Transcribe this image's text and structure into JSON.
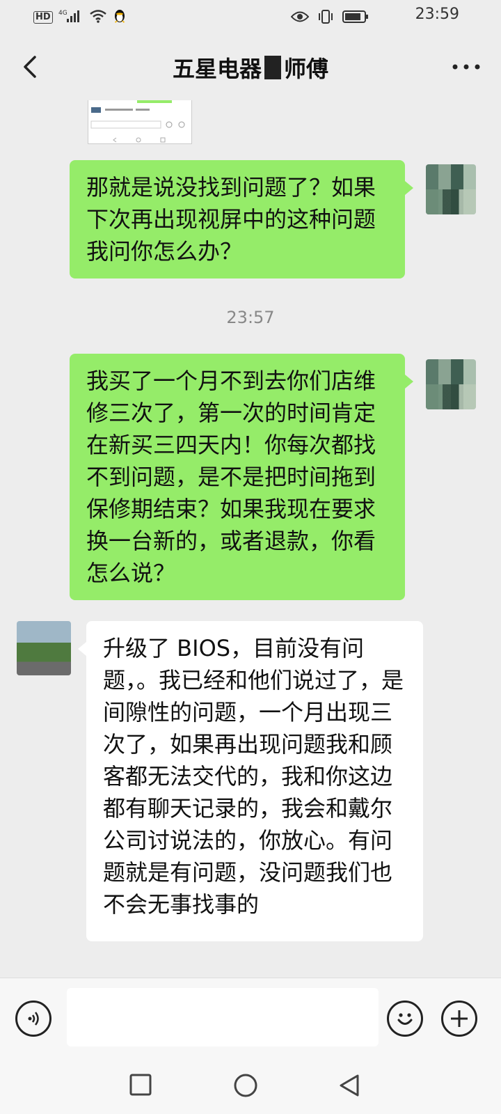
{
  "status_bar": {
    "network": "HD",
    "signal": "4G",
    "time": "23:59"
  },
  "header": {
    "title_before": "五星电器",
    "title_after": "师傅"
  },
  "messages": [
    {
      "direction": "out",
      "text": "那就是说没找到问题了？如果下次再出现视屏中的这种问题我问你怎么办？"
    },
    {
      "type": "timestamp",
      "text": "23:57"
    },
    {
      "direction": "out",
      "text": "我买了一个月不到去你们店维修三次了，第一次的时间肯定在新买三四天内！你每次都找不到问题，是不是把时间拖到保修期结束？如果我现在要求换一台新的，或者退款，你看怎么说？"
    },
    {
      "direction": "in",
      "text": "升级了 BIOS，目前没有问题，。我已经和他们说过了，是间隙性的问题，一个月出现三次了，如果再出现问题我和顾客都无法交代的，我和你这边都有聊天记录的，我会和戴尔公司讨说法的，你放心。有问题就是有问题，没问题我们也不会无事找事的"
    }
  ],
  "colors": {
    "outgoing_bubble": "#95ec69",
    "incoming_bubble": "#ffffff",
    "background": "#ededed"
  }
}
